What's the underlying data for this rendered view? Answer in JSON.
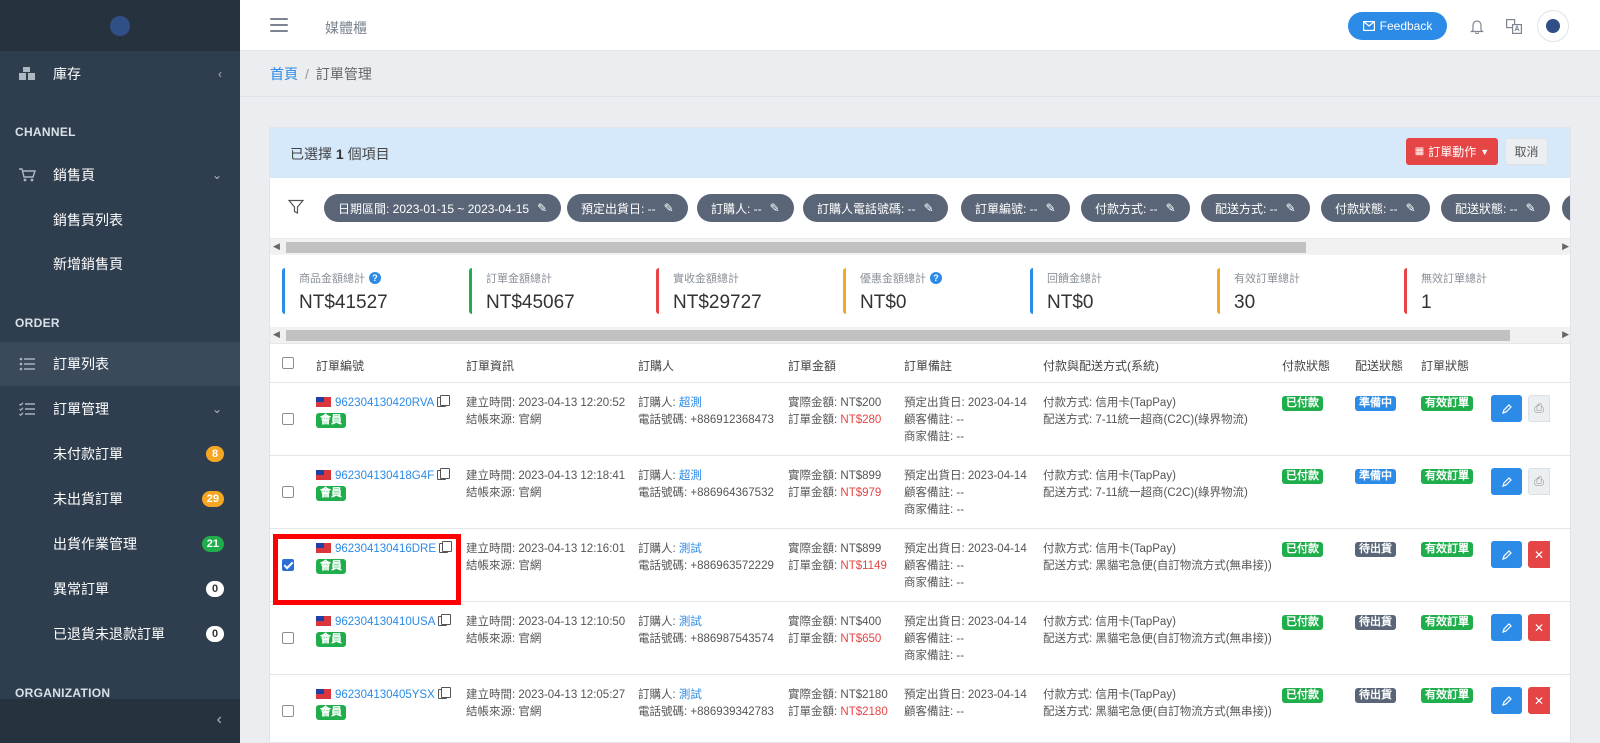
{
  "sidebar": {
    "top_item": {
      "label": "庫存"
    },
    "sections": [
      "CHANNEL",
      "ORDER",
      "ORGANIZATION"
    ],
    "channel_items": [
      {
        "label": "銷售頁"
      },
      {
        "label": "銷售頁列表"
      },
      {
        "label": "新增銷售頁"
      }
    ],
    "order_items": [
      {
        "label": "訂單列表"
      },
      {
        "label": "訂單管理"
      },
      {
        "label": "未付款訂單",
        "badge": "8",
        "badge_color": "#f5a623"
      },
      {
        "label": "未出貨訂單",
        "badge": "29",
        "badge_color": "#f5a623"
      },
      {
        "label": "出貨作業管理",
        "badge": "21",
        "badge_color": "#1fae4b"
      },
      {
        "label": "異常訂單",
        "badge": "0",
        "badge_color": "#ffffff"
      },
      {
        "label": "已退貨未退款訂單",
        "badge": "0",
        "badge_color": "#ffffff"
      }
    ]
  },
  "header": {
    "title": "媒體櫃",
    "feedback_label": "Feedback"
  },
  "breadcrumb": {
    "home": "首頁",
    "sep": "/",
    "current": "訂單管理"
  },
  "selection": {
    "prefix": "已選擇",
    "count": "1",
    "suffix": "個項目",
    "action_label": "訂單動作",
    "cancel_label": "取消"
  },
  "filters": [
    "日期區間: 2023-01-15 ~ 2023-04-15",
    "預定出貨日: --",
    "訂購人: --",
    "訂購人電話號碼: --",
    "訂單編號: --",
    "付款方式: --",
    "配送方式: --",
    "付款狀態: --",
    "配送狀態: --"
  ],
  "stats": [
    {
      "label": "商品金額總計",
      "value": "NT$41527",
      "color": "#2b8be6",
      "help": "?"
    },
    {
      "label": "訂單金額總計",
      "value": "NT$45067",
      "color": "#1fae4b"
    },
    {
      "label": "實收金額總計",
      "value": "NT$29727",
      "color": "#e64545"
    },
    {
      "label": "優惠金額總計",
      "value": "NT$0",
      "color": "#f5a623",
      "help": "?"
    },
    {
      "label": "回饋金總計",
      "value": "NT$0",
      "color": "#2b8be6"
    },
    {
      "label": "有效訂單總計",
      "value": "30",
      "color": "#f5a623"
    },
    {
      "label": "無效訂單總計",
      "value": "1",
      "color": "#e64545"
    }
  ],
  "table": {
    "headers": [
      "訂單編號",
      "訂單資訊",
      "訂購人",
      "訂單金額",
      "訂單備註",
      "付款與配送方式(系統)",
      "付款狀態",
      "配送狀態",
      "訂單狀態"
    ],
    "rows": [
      {
        "id": "962304130420RVA",
        "member": "會員",
        "created": "建立時間: 2023-04-13 12:20:52",
        "source": "結帳來源: 官網",
        "buyer_prefix": "訂購人:",
        "buyer": "超測",
        "phone": "電話號碼: +886912368473",
        "actual_prefix": "實際金額:",
        "actual": "NT$200",
        "order_prefix": "訂單金額:",
        "order_amt": "NT$280",
        "ship_date": "預定出貨日: 2023-04-14",
        "cust_note": "顧客備註: --",
        "merchant_note": "商家備註: --",
        "pay": "付款方式: 信用卡(TapPay)",
        "delivery": "配送方式: 7-11統一超商(C2C)(綠界物流)",
        "pay_status": "已付款",
        "ship_status": "準備中",
        "ship_status_class": "blue",
        "order_status": "有效訂單",
        "checked": false,
        "side": "⎙"
      },
      {
        "id": "962304130418G4F",
        "member": "會員",
        "created": "建立時間: 2023-04-13 12:18:41",
        "source": "結帳來源: 官網",
        "buyer_prefix": "訂購人:",
        "buyer": "超測",
        "phone": "電話號碼: +886964367532",
        "actual_prefix": "實際金額:",
        "actual": "NT$899",
        "order_prefix": "訂單金額:",
        "order_amt": "NT$979",
        "ship_date": "預定出貨日: 2023-04-14",
        "cust_note": "顧客備註: --",
        "merchant_note": "商家備註: --",
        "pay": "付款方式: 信用卡(TapPay)",
        "delivery": "配送方式: 7-11統一超商(C2C)(綠界物流)",
        "pay_status": "已付款",
        "ship_status": "準備中",
        "ship_status_class": "blue",
        "order_status": "有效訂單",
        "checked": false,
        "side": "⎙"
      },
      {
        "id": "962304130416DRE",
        "member": "會員",
        "created": "建立時間: 2023-04-13 12:16:01",
        "source": "結帳來源: 官網",
        "buyer_prefix": "訂購人:",
        "buyer": "測試",
        "phone": "電話號碼: +886963572229",
        "actual_prefix": "實際金額:",
        "actual": "NT$899",
        "order_prefix": "訂單金額:",
        "order_amt": "NT$1149",
        "ship_date": "預定出貨日: 2023-04-14",
        "cust_note": "顧客備註: --",
        "merchant_note": "商家備註: --",
        "pay": "付款方式: 信用卡(TapPay)",
        "delivery": "配送方式: 黑貓宅急便(自訂物流方式(無串接))",
        "pay_status": "已付款",
        "ship_status": "待出貨",
        "ship_status_class": "dark",
        "order_status": "有效訂單",
        "checked": true,
        "side": "✕"
      },
      {
        "id": "962304130410USA",
        "member": "會員",
        "created": "建立時間: 2023-04-13 12:10:50",
        "source": "結帳來源: 官網",
        "buyer_prefix": "訂購人:",
        "buyer": "測試",
        "phone": "電話號碼: +886987543574",
        "actual_prefix": "實際金額:",
        "actual": "NT$400",
        "order_prefix": "訂單金額:",
        "order_amt": "NT$650",
        "ship_date": "預定出貨日: 2023-04-14",
        "cust_note": "顧客備註: --",
        "merchant_note": "商家備註: --",
        "pay": "付款方式: 信用卡(TapPay)",
        "delivery": "配送方式: 黑貓宅急便(自訂物流方式(無串接))",
        "pay_status": "已付款",
        "ship_status": "待出貨",
        "ship_status_class": "dark",
        "order_status": "有效訂單",
        "checked": false,
        "side": "✕"
      },
      {
        "id": "962304130405YSX",
        "member": "會員",
        "created": "建立時間: 2023-04-13 12:05:27",
        "source": "結帳來源: 官網",
        "buyer_prefix": "訂購人:",
        "buyer": "測試",
        "phone": "電話號碼: +886939342783",
        "actual_prefix": "實際金額:",
        "actual": "NT$2180",
        "order_prefix": "訂單金額:",
        "order_amt": "NT$2180",
        "ship_date": "預定出貨日: 2023-04-14",
        "cust_note": "顧客備註: --",
        "merchant_note": "",
        "pay": "付款方式: 信用卡(TapPay)",
        "delivery": "配送方式: 黑貓宅急便(自訂物流方式(無串接))",
        "pay_status": "已付款",
        "ship_status": "待出貨",
        "ship_status_class": "dark",
        "order_status": "有效訂單",
        "checked": false,
        "side": "✕"
      }
    ]
  },
  "colors": {
    "accent": "#2b8be6",
    "danger": "#e64545",
    "success": "#1fae4b",
    "warning": "#f5a623",
    "sidebar": "#2f3e4e"
  }
}
